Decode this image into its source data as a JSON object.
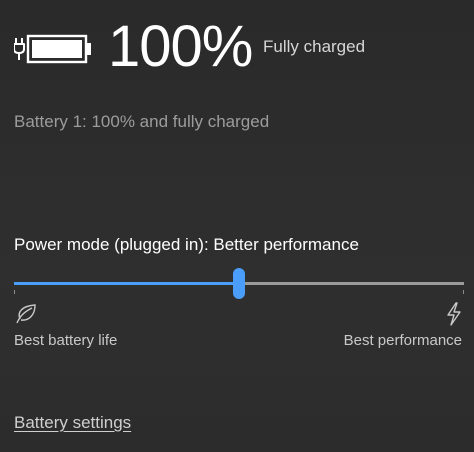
{
  "battery": {
    "icon": "battery-charging-full-icon",
    "percent_text": "100%",
    "charge_state": "Fully charged",
    "detail": "Battery 1: 100% and fully charged"
  },
  "power_mode": {
    "label": "Power mode (plugged in): Better performance",
    "slider_level": 0.5,
    "left_icon": "leaf-icon",
    "right_icon": "lightning-bolt-icon",
    "left_label": "Best battery life",
    "right_label": "Best performance"
  },
  "links": {
    "battery_settings": "Battery settings"
  },
  "colors": {
    "accent": "#4a9df8",
    "track_inactive": "#9a9a9a",
    "background": "#2c2c2c"
  }
}
